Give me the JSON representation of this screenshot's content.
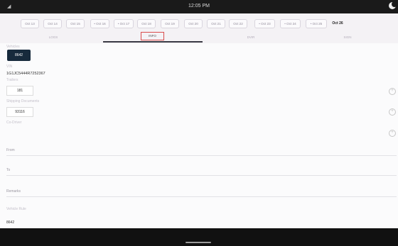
{
  "status_bar": {
    "time": "12:05 PM"
  },
  "date_chips": [
    {
      "label": "Oct 13",
      "dot": false,
      "selected": false
    },
    {
      "label": "Oct 14",
      "dot": false,
      "selected": false
    },
    {
      "label": "Oct 15",
      "dot": false,
      "selected": false
    },
    {
      "label": "Oct 16",
      "dot": true,
      "selected": false
    },
    {
      "label": "Oct 17",
      "dot": true,
      "selected": false
    },
    {
      "label": "Oct 18",
      "dot": false,
      "selected": false
    },
    {
      "label": "Oct 19",
      "dot": false,
      "selected": false
    },
    {
      "label": "Oct 20",
      "dot": false,
      "selected": false
    },
    {
      "label": "Oct 21",
      "dot": false,
      "selected": false
    },
    {
      "label": "Oct 22",
      "dot": false,
      "selected": false
    },
    {
      "label": "Oct 23",
      "dot": true,
      "selected": false
    },
    {
      "label": "Oct 24",
      "dot": true,
      "selected": false
    },
    {
      "label": "Oct 25",
      "dot": true,
      "selected": false
    },
    {
      "label": "Oct 26",
      "dot": false,
      "selected": true
    }
  ],
  "tabs": [
    {
      "label": "LOGS",
      "active": false
    },
    {
      "label": "INFO",
      "active": true
    },
    {
      "label": "DVIR",
      "active": false
    },
    {
      "label": "SIGN",
      "active": false
    }
  ],
  "form": {
    "vehicle_label": "Vehicles",
    "vehicle_value": "8642",
    "vin_label": "VIN",
    "vin_value": "1G1JC5444R7252367",
    "trailers_label": "Trailers",
    "trailers_value": "181",
    "shipping_label": "Shipping Documents",
    "shipping_value": "93116",
    "codrivers_label": "Co-Driver",
    "from_label": "From",
    "to_label": "To",
    "remarks_label": "Remarks",
    "vehicle_rule_label": "Vehicle Rule",
    "bottom_value": "8642"
  },
  "colors": {
    "accent_dark": "#172a3c",
    "tab_highlight": "#d94c4c",
    "header_bg": "#f4f2f5"
  }
}
